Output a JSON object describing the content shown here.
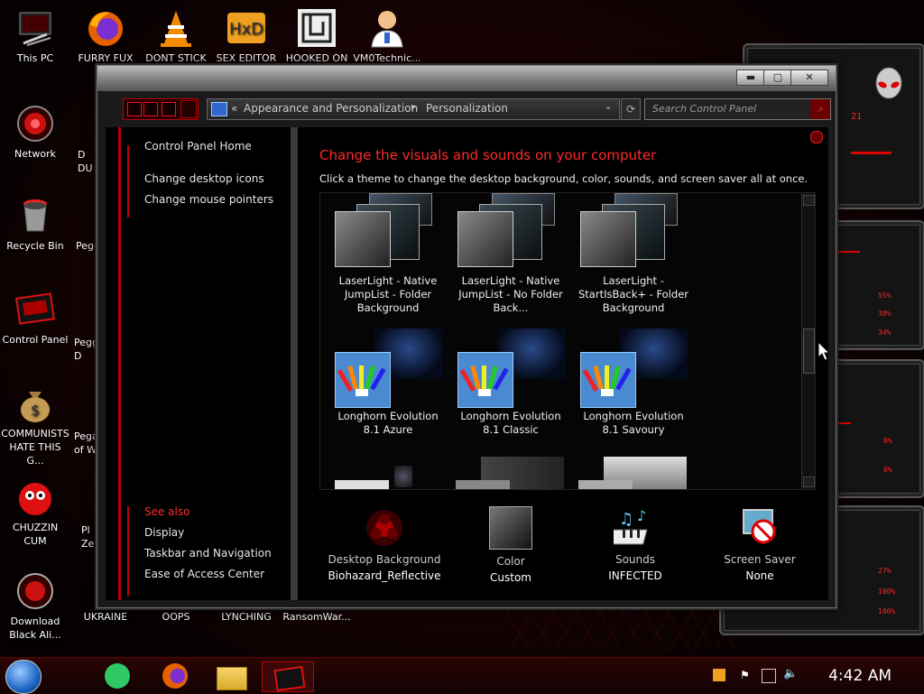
{
  "desktop": {
    "icons": [
      {
        "label": "This PC"
      },
      {
        "label": "FURRY FUX"
      },
      {
        "label": "DONT STICK"
      },
      {
        "label": "SEX EDITOR"
      },
      {
        "label": "HOOKED ON"
      },
      {
        "label": "VM0Technic..."
      },
      {
        "label": "Network"
      },
      {
        "label": "Recycle Bin"
      },
      {
        "label": "Control Panel"
      },
      {
        "label": "COMMUNISTS HATE THIS G..."
      },
      {
        "label": "CHUZZIN CUM"
      },
      {
        "label": "Download Black Ali..."
      },
      {
        "label": "UKRAINE"
      },
      {
        "label": "OOPS"
      },
      {
        "label": "LYNCHING"
      },
      {
        "label": "RansomWar..."
      }
    ],
    "partial_labels": [
      "D DU",
      "Pegg",
      "Pegg D",
      "Pega of W",
      "Pl Ze"
    ]
  },
  "gadget": {
    "readouts": [
      "55%",
      "38%",
      "34%",
      "0%",
      "0%",
      "27%",
      "100%",
      "100%"
    ],
    "counter": "21"
  },
  "window": {
    "address": {
      "prefix": "«",
      "crumb1": "Appearance and Personalization",
      "sep": "▸",
      "crumb2": "Personalization"
    },
    "search_placeholder": "Search Control Panel",
    "left": {
      "home": "Control Panel Home",
      "links": [
        "Change desktop icons",
        "Change mouse pointers"
      ],
      "see_also_title": "See also",
      "see_also": [
        "Display",
        "Taskbar and Navigation",
        "Ease of Access Center"
      ]
    },
    "heading": "Change the visuals and sounds on your computer",
    "subheading": "Click a theme to change the desktop background, color, sounds, and screen saver all at once.",
    "themes": [
      {
        "label": "LaserLight - Native JumpList - Folder Background"
      },
      {
        "label": "LaserLight - Native JumpList - No Folder Back..."
      },
      {
        "label": "LaserLight - StartIsBack+ - Folder Background"
      },
      {
        "label": "Longhorn Evolution 8.1 Azure"
      },
      {
        "label": "Longhorn Evolution 8.1 Classic"
      },
      {
        "label": "Longhorn Evolution 8.1 Savoury"
      }
    ],
    "bottom": [
      {
        "title": "Desktop Background",
        "value": "Biohazard_Reflective"
      },
      {
        "title": "Color",
        "value": "Custom"
      },
      {
        "title": "Sounds",
        "value": "INFECTED"
      },
      {
        "title": "Screen Saver",
        "value": "None"
      }
    ]
  },
  "taskbar": {
    "clock": "4:42 AM"
  },
  "colors": {
    "accent_red": "#ff2a2a",
    "rail_red": "#b00000"
  }
}
